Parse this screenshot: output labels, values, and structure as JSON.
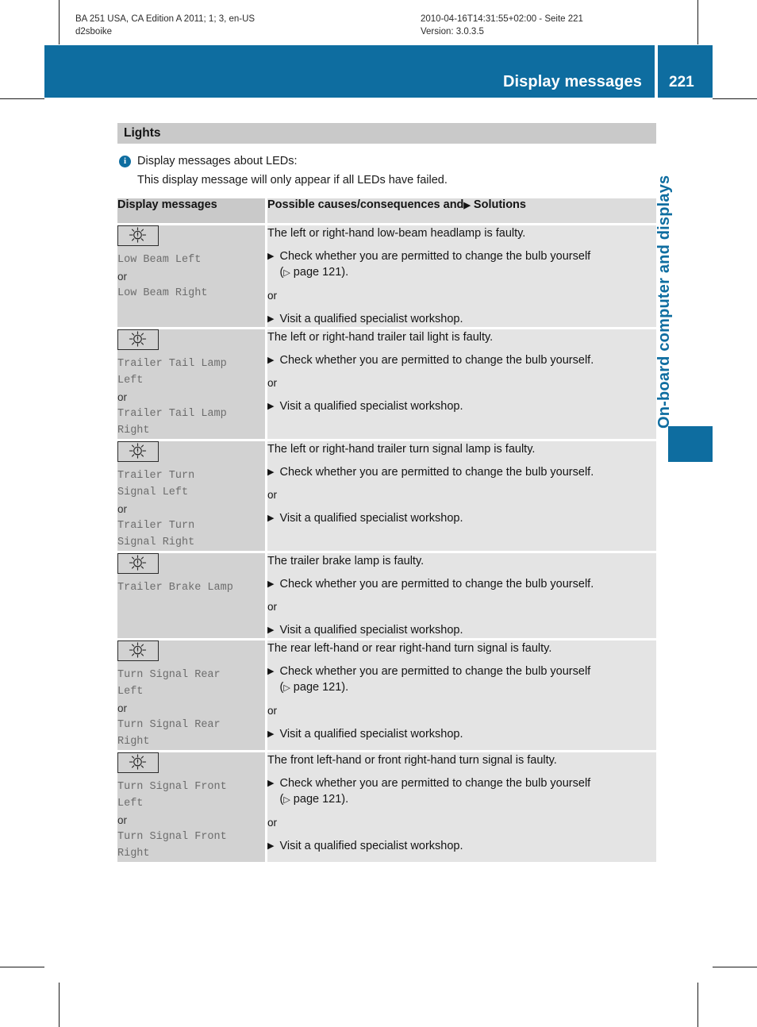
{
  "print_meta": {
    "left_line_1": "BA 251 USA, CA Edition A 2011; 1; 3, en-US",
    "left_line_2": "d2sboike",
    "right_line_1": "2010-04-16T14:31:55+02:00 - Seite 221",
    "right_line_2": "Version: 3.0.3.5"
  },
  "header": {
    "title": "Display messages",
    "page_number": "221",
    "accent_color": "#0E6DA0"
  },
  "side_tab": {
    "chapter_label": "On-board computer and displays"
  },
  "section": {
    "heading": "Lights",
    "note": {
      "icon": "info-icon",
      "title": "Display messages about LEDs:",
      "body": "This display message will only appear if all LEDs have failed."
    }
  },
  "table": {
    "headers": {
      "left": "Display messages",
      "right_pre": "Possible causes/consequences and",
      "right_triangle": "▶",
      "right_post": "Solutions"
    },
    "glyphs": {
      "solid_triangle": "▶",
      "open_triangle": "▷"
    },
    "rows": [
      {
        "icon": "lamp-failure-icon",
        "messages": [
          {
            "type": "msg",
            "text": "Low Beam Left"
          },
          {
            "type": "or",
            "text": "or"
          },
          {
            "type": "msg",
            "text": "Low Beam Right"
          }
        ],
        "cause": "The left or right-hand low-beam headlamp is faulty.",
        "items": [
          {
            "type": "solution",
            "text": "Check whether you are permitted to change the bulb yourself",
            "page_ref": "page 121",
            "page_ref_prefix": "(",
            "page_ref_suffix": ")."
          },
          {
            "type": "or",
            "text": "or"
          },
          {
            "type": "solution",
            "text": "Visit a qualified specialist workshop."
          }
        ]
      },
      {
        "icon": "lamp-failure-icon",
        "messages": [
          {
            "type": "msg",
            "text": "Trailer Tail Lamp\nLeft"
          },
          {
            "type": "or",
            "text": "or"
          },
          {
            "type": "msg",
            "text": "Trailer Tail Lamp\nRight"
          }
        ],
        "cause": "The left or right-hand trailer tail light is faulty.",
        "items": [
          {
            "type": "solution",
            "text": "Check whether you are permitted to change the bulb yourself."
          },
          {
            "type": "or",
            "text": "or"
          },
          {
            "type": "solution",
            "text": "Visit a qualified specialist workshop."
          }
        ]
      },
      {
        "icon": "lamp-failure-icon",
        "messages": [
          {
            "type": "msg",
            "text": "Trailer Turn\nSignal Left"
          },
          {
            "type": "or",
            "text": "or"
          },
          {
            "type": "msg",
            "text": "Trailer Turn\nSignal Right"
          }
        ],
        "cause": "The left or right-hand trailer turn signal lamp is faulty.",
        "items": [
          {
            "type": "solution",
            "text": "Check whether you are permitted to change the bulb yourself."
          },
          {
            "type": "or",
            "text": "or"
          },
          {
            "type": "solution",
            "text": "Visit a qualified specialist workshop."
          }
        ]
      },
      {
        "icon": "lamp-failure-icon",
        "messages": [
          {
            "type": "msg",
            "text": "Trailer Brake Lamp"
          }
        ],
        "cause": "The trailer brake lamp is faulty.",
        "items": [
          {
            "type": "solution",
            "text": "Check whether you are permitted to change the bulb yourself."
          },
          {
            "type": "or",
            "text": "or"
          },
          {
            "type": "solution",
            "text": "Visit a qualified specialist workshop."
          }
        ]
      },
      {
        "icon": "lamp-failure-icon",
        "messages": [
          {
            "type": "msg",
            "text": "Turn Signal Rear\nLeft"
          },
          {
            "type": "or",
            "text": "or"
          },
          {
            "type": "msg",
            "text": "Turn Signal Rear\nRight"
          }
        ],
        "cause": "The rear left-hand or rear right-hand turn signal is faulty.",
        "items": [
          {
            "type": "solution",
            "text": "Check whether you are permitted to change the bulb yourself",
            "page_ref": "page 121",
            "page_ref_prefix": "(",
            "page_ref_suffix": ")."
          },
          {
            "type": "or",
            "text": "or"
          },
          {
            "type": "solution",
            "text": "Visit a qualified specialist workshop."
          }
        ]
      },
      {
        "icon": "lamp-failure-icon",
        "messages": [
          {
            "type": "msg",
            "text": "Turn Signal Front\nLeft"
          },
          {
            "type": "or",
            "text": "or"
          },
          {
            "type": "msg",
            "text": "Turn Signal Front\nRight"
          }
        ],
        "cause": "The front left-hand or front right-hand turn signal is faulty.",
        "items": [
          {
            "type": "solution",
            "text": "Check whether you are permitted to change the bulb yourself",
            "page_ref": "page 121",
            "page_ref_prefix": "(",
            "page_ref_suffix": ")."
          },
          {
            "type": "or",
            "text": "or"
          },
          {
            "type": "solution",
            "text": "Visit a qualified specialist workshop."
          }
        ]
      }
    ]
  }
}
